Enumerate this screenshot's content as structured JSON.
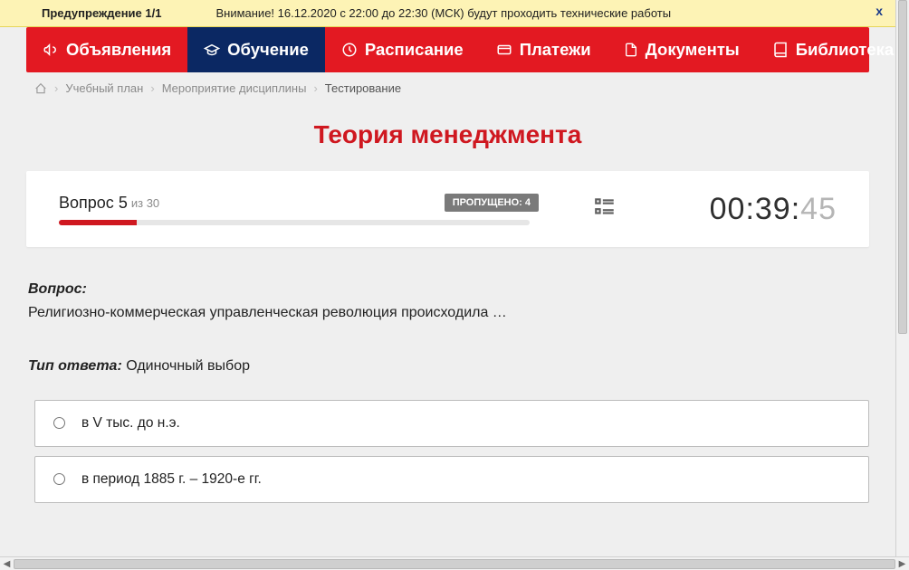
{
  "warning": {
    "prefix": "Предупреждение 1/1",
    "message": "Внимание! 16.12.2020 с 22:00 до 22:30 (МСК) будут проходить технические работы",
    "close": "x"
  },
  "nav": {
    "items": [
      {
        "label": "Объявления"
      },
      {
        "label": "Обучение"
      },
      {
        "label": "Расписание"
      },
      {
        "label": "Платежи"
      },
      {
        "label": "Документы"
      },
      {
        "label": "Библиотека"
      }
    ]
  },
  "breadcrumbs": {
    "items": [
      "Учебный план",
      "Мероприятие дисциплины",
      "Тестирование"
    ]
  },
  "title": "Теория менеджмента",
  "progress": {
    "question_prefix": "Вопрос",
    "question_num": "5",
    "question_sep": "из",
    "question_total": "30",
    "skipped_label": "ПРОПУЩЕНО: 4"
  },
  "timer": {
    "mm": "00",
    "s1": "39",
    "s2": "45",
    "c": ":"
  },
  "question": {
    "label": "Вопрос:",
    "text": "Религиозно-коммерческая управленческая революция происходила …",
    "type_label": "Тип ответа:",
    "type_value": " Одиночный выбор"
  },
  "answers": [
    {
      "text": "в V тыс. до н.э."
    },
    {
      "text": "в период 1885 г. – 1920-е гг."
    }
  ]
}
